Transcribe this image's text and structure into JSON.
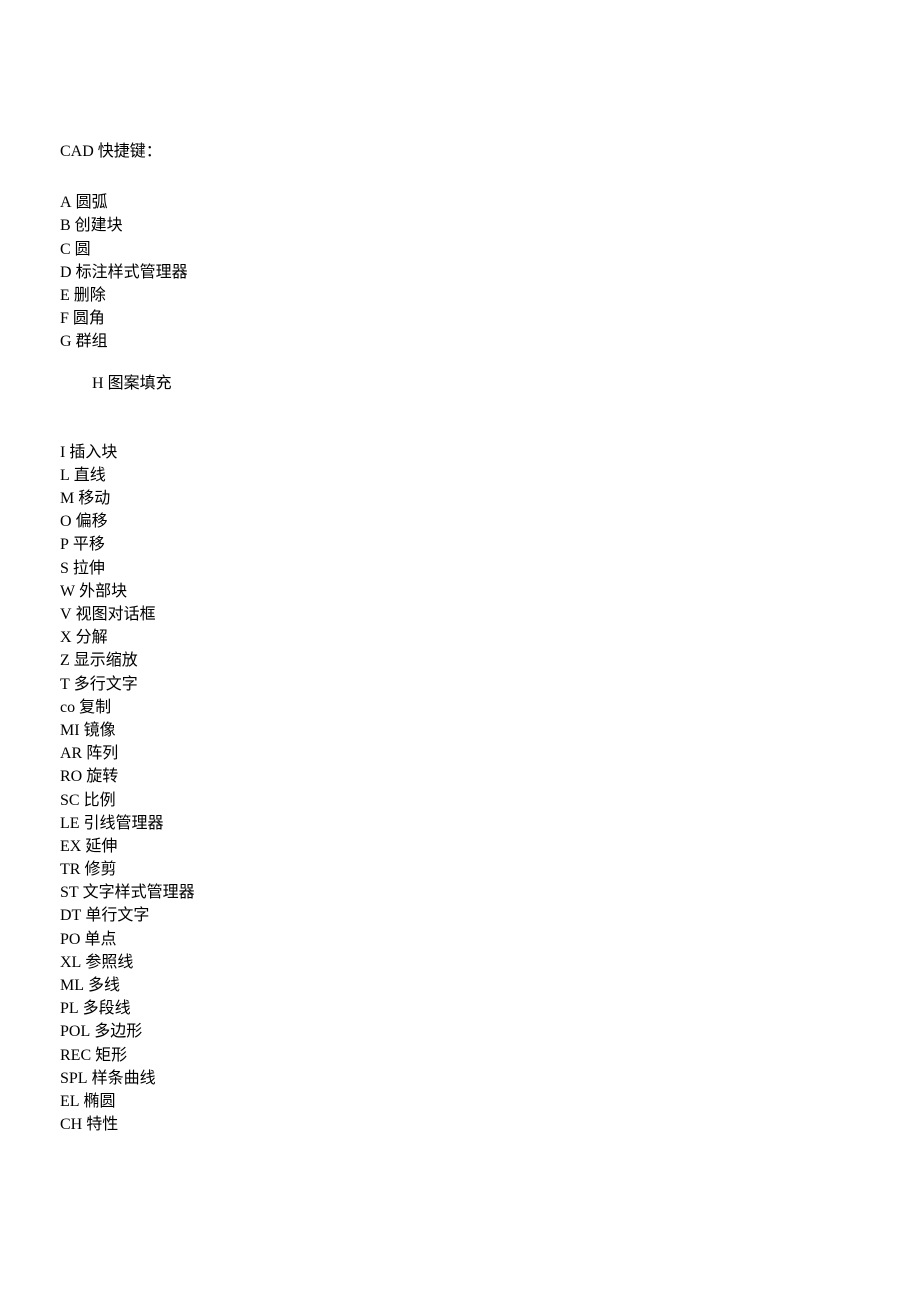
{
  "title": "CAD 快捷键：",
  "group1": [
    {
      "key": "A",
      "desc": "圆弧"
    },
    {
      "key": "B",
      "desc": "创建块"
    },
    {
      "key": "C",
      "desc": "圆"
    },
    {
      "key": "D",
      "desc": "标注样式管理器"
    },
    {
      "key": "E",
      "desc": "删除"
    },
    {
      "key": "F",
      "desc": "圆角"
    },
    {
      "key": "G",
      "desc": "群组"
    }
  ],
  "indented": {
    "key": "H",
    "desc": "图案填充"
  },
  "group2": [
    {
      "key": "I",
      "desc": "插入块"
    },
    {
      "key": "L",
      "desc": "直线"
    },
    {
      "key": "M",
      "desc": "移动"
    },
    {
      "key": "O",
      "desc": "偏移"
    },
    {
      "key": "P",
      "desc": "平移"
    },
    {
      "key": "S",
      "desc": "拉伸"
    },
    {
      "key": "W",
      "desc": "外部块"
    },
    {
      "key": "V",
      "desc": "视图对话框"
    },
    {
      "key": "X",
      "desc": "分解"
    },
    {
      "key": "Z",
      "desc": "显示缩放"
    },
    {
      "key": "T",
      "desc": "多行文字"
    },
    {
      "key": "co",
      "desc": "复制"
    },
    {
      "key": "MI",
      "desc": "镜像"
    },
    {
      "key": "AR",
      "desc": "阵列"
    },
    {
      "key": "RO",
      "desc": "旋转"
    },
    {
      "key": "SC",
      "desc": "比例"
    },
    {
      "key": "LE",
      "desc": "引线管理器"
    },
    {
      "key": "EX",
      "desc": "延伸"
    },
    {
      "key": "TR",
      "desc": "修剪"
    },
    {
      "key": "ST",
      "desc": "文字样式管理器"
    },
    {
      "key": "DT",
      "desc": "单行文字"
    },
    {
      "key": "PO",
      "desc": "单点"
    },
    {
      "key": "XL",
      "desc": "参照线"
    },
    {
      "key": "ML",
      "desc": "多线"
    },
    {
      "key": "PL",
      "desc": "多段线"
    },
    {
      "key": "POL",
      "desc": "多边形"
    },
    {
      "key": "REC",
      "desc": "矩形"
    },
    {
      "key": "SPL",
      "desc": "样条曲线"
    },
    {
      "key": "EL",
      "desc": "椭圆"
    },
    {
      "key": "CH",
      "desc": "特性"
    }
  ]
}
